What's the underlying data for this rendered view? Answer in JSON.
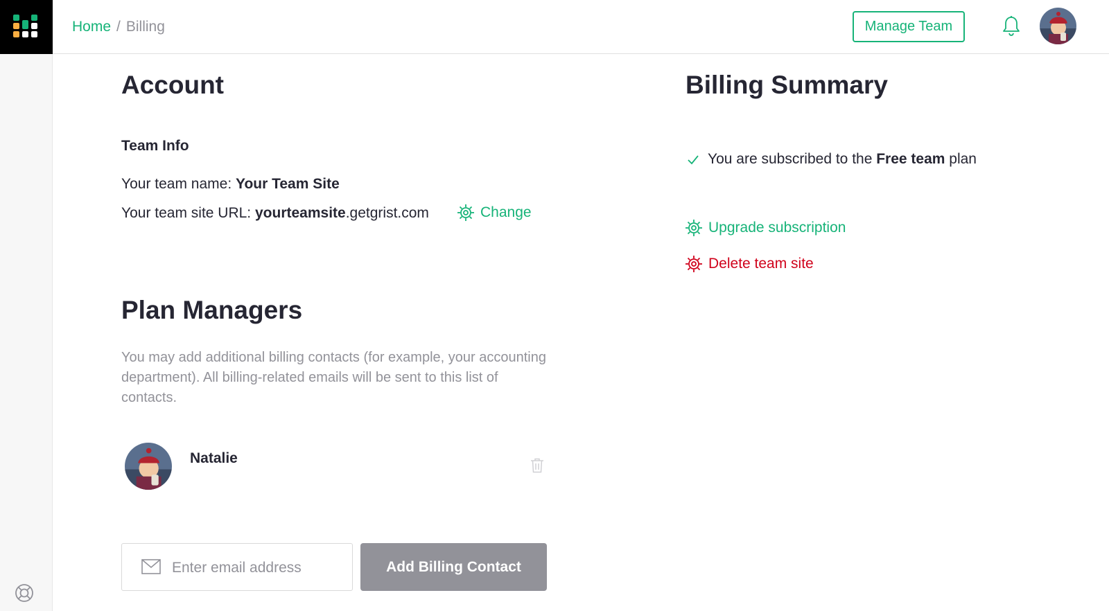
{
  "breadcrumb": {
    "home": "Home",
    "separator": "/",
    "current": "Billing"
  },
  "header": {
    "manage_team_label": "Manage Team",
    "bell_icon": "bell-icon",
    "avatar_icon": "user-avatar"
  },
  "account": {
    "title": "Account",
    "team_info_heading": "Team Info",
    "team_name_label": "Your team name: ",
    "team_name_value": "Your Team Site",
    "team_url_label": "Your team site URL: ",
    "team_url_subdomain": "yourteamsite",
    "team_url_domain": ".getgrist.com",
    "change_label": "Change"
  },
  "plan_managers": {
    "title": "Plan Managers",
    "description": "You may add additional billing contacts (for example, your accounting department). All billing-related emails will be sent to this list of contacts.",
    "managers": [
      {
        "name": "Natalie"
      }
    ],
    "email_placeholder": "Enter email address",
    "email_value": "",
    "add_button_label": "Add Billing Contact"
  },
  "billing_summary": {
    "title": "Billing Summary",
    "status_prefix": "You are subscribed to the ",
    "status_plan": "Free team",
    "status_suffix": " plan",
    "upgrade_label": "Upgrade subscription",
    "delete_label": "Delete team site"
  },
  "colors": {
    "accent": "#16b378",
    "danger": "#d0021b",
    "muted": "#929299",
    "text": "#262633"
  }
}
